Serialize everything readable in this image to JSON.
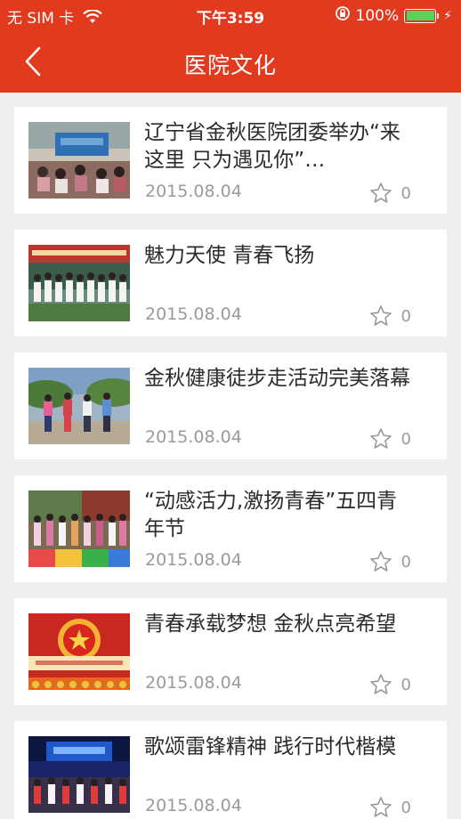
{
  "status_bar": {
    "carrier": "无 SIM 卡",
    "time": "下午3:59",
    "battery_percent": "100%",
    "battery_color": "#56d35b"
  },
  "nav": {
    "back_icon": "chevron-left-icon",
    "title": "医院文化",
    "bar_color": "#e23a1f"
  },
  "articles": [
    {
      "title": "辽宁省金秋医院团委举办“来这里 只为遇见你”…",
      "date": "2015.08.04",
      "favorites": "0"
    },
    {
      "title": "魅力天使 青春飞扬",
      "date": "2015.08.04",
      "favorites": "0"
    },
    {
      "title": "金秋健康徒步走活动完美落幕",
      "date": "2015.08.04",
      "favorites": "0"
    },
    {
      "title": "“动感活力,激扬青春”五四青年节",
      "date": "2015.08.04",
      "favorites": "0"
    },
    {
      "title": "青春承载梦想 金秋点亮希望",
      "date": "2015.08.04",
      "favorites": "0"
    },
    {
      "title": "歌颂雷锋精神 践行时代楷模",
      "date": "2015.08.04",
      "favorites": "0"
    }
  ]
}
